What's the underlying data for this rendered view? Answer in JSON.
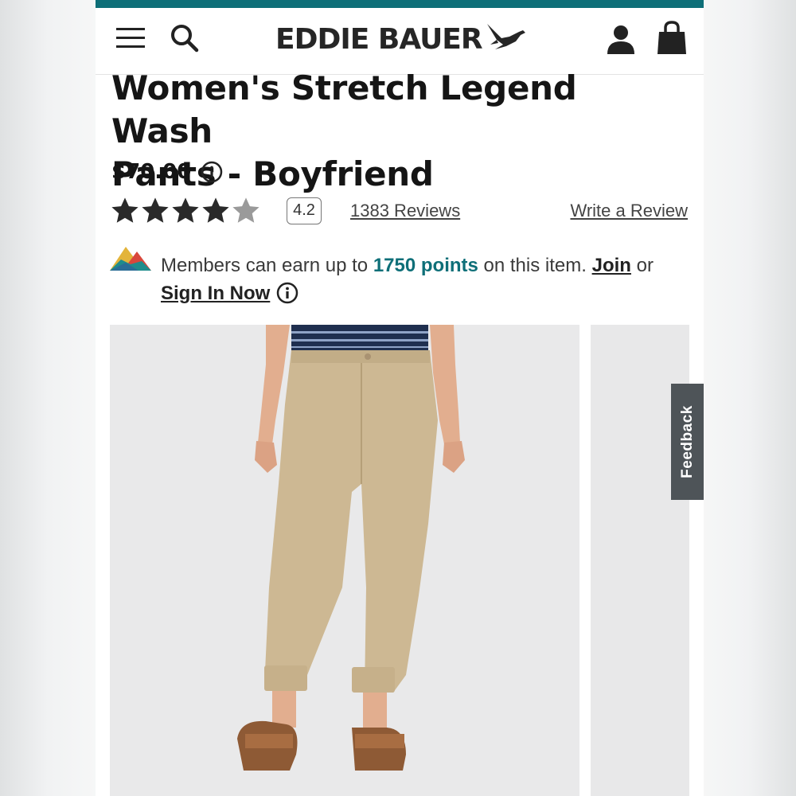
{
  "header": {
    "brand": "EDDIE BAUER",
    "menu_icon": "hamburger-menu-icon",
    "search_icon": "search-icon",
    "logo_icon": "goose-logo-icon",
    "account_icon": "user-account-icon",
    "bag_icon": "shopping-bag-icon",
    "accent_color": "#0e6f78"
  },
  "product": {
    "title_line1": "Women's Stretch Legend Wash",
    "title_line2": "Pants - Boyfriend",
    "price": "$70.00",
    "price_info_icon": "info-icon"
  },
  "rating": {
    "stars_filled": 4,
    "stars_total": 5,
    "value": "4.2",
    "reviews_link": "1383 Reviews",
    "write_review": "Write a Review"
  },
  "rewards": {
    "icon": "mountains-rewards-icon",
    "text_before": "Members can earn up to ",
    "points": "1750 points",
    "text_after": " on this item. ",
    "join": "Join",
    "or": " or",
    "sign_in": "Sign In Now",
    "info_icon": "info-icon"
  },
  "gallery": {
    "main_image": "khaki-pants-model-photo",
    "next_image": "next-product-photo"
  },
  "feedback": {
    "label": "Feedback"
  }
}
